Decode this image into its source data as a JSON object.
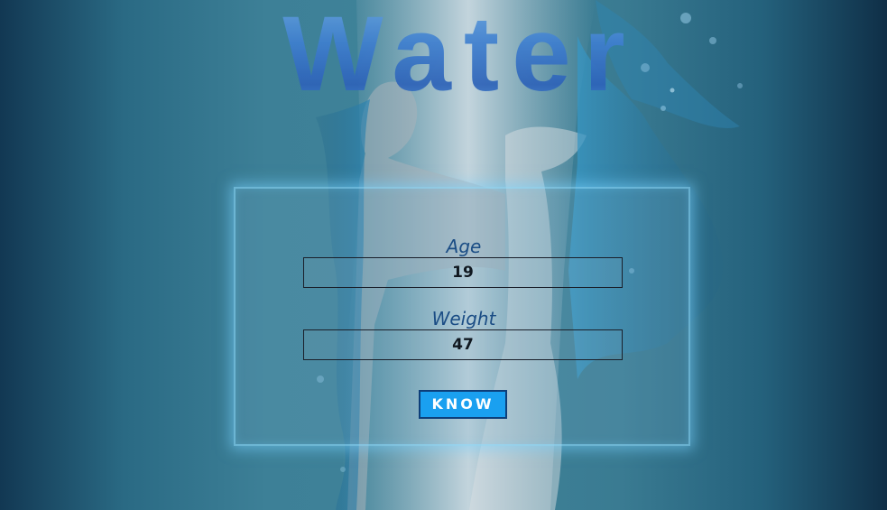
{
  "header": {
    "title": "Water"
  },
  "form": {
    "age": {
      "label": "Age",
      "value": "19"
    },
    "weight": {
      "label": "Weight",
      "value": "47"
    },
    "submit_label": "KNOW"
  },
  "colors": {
    "accent": "#1aa0f0",
    "label_text": "#1b4d85",
    "card_glow": "#78d2ff"
  }
}
